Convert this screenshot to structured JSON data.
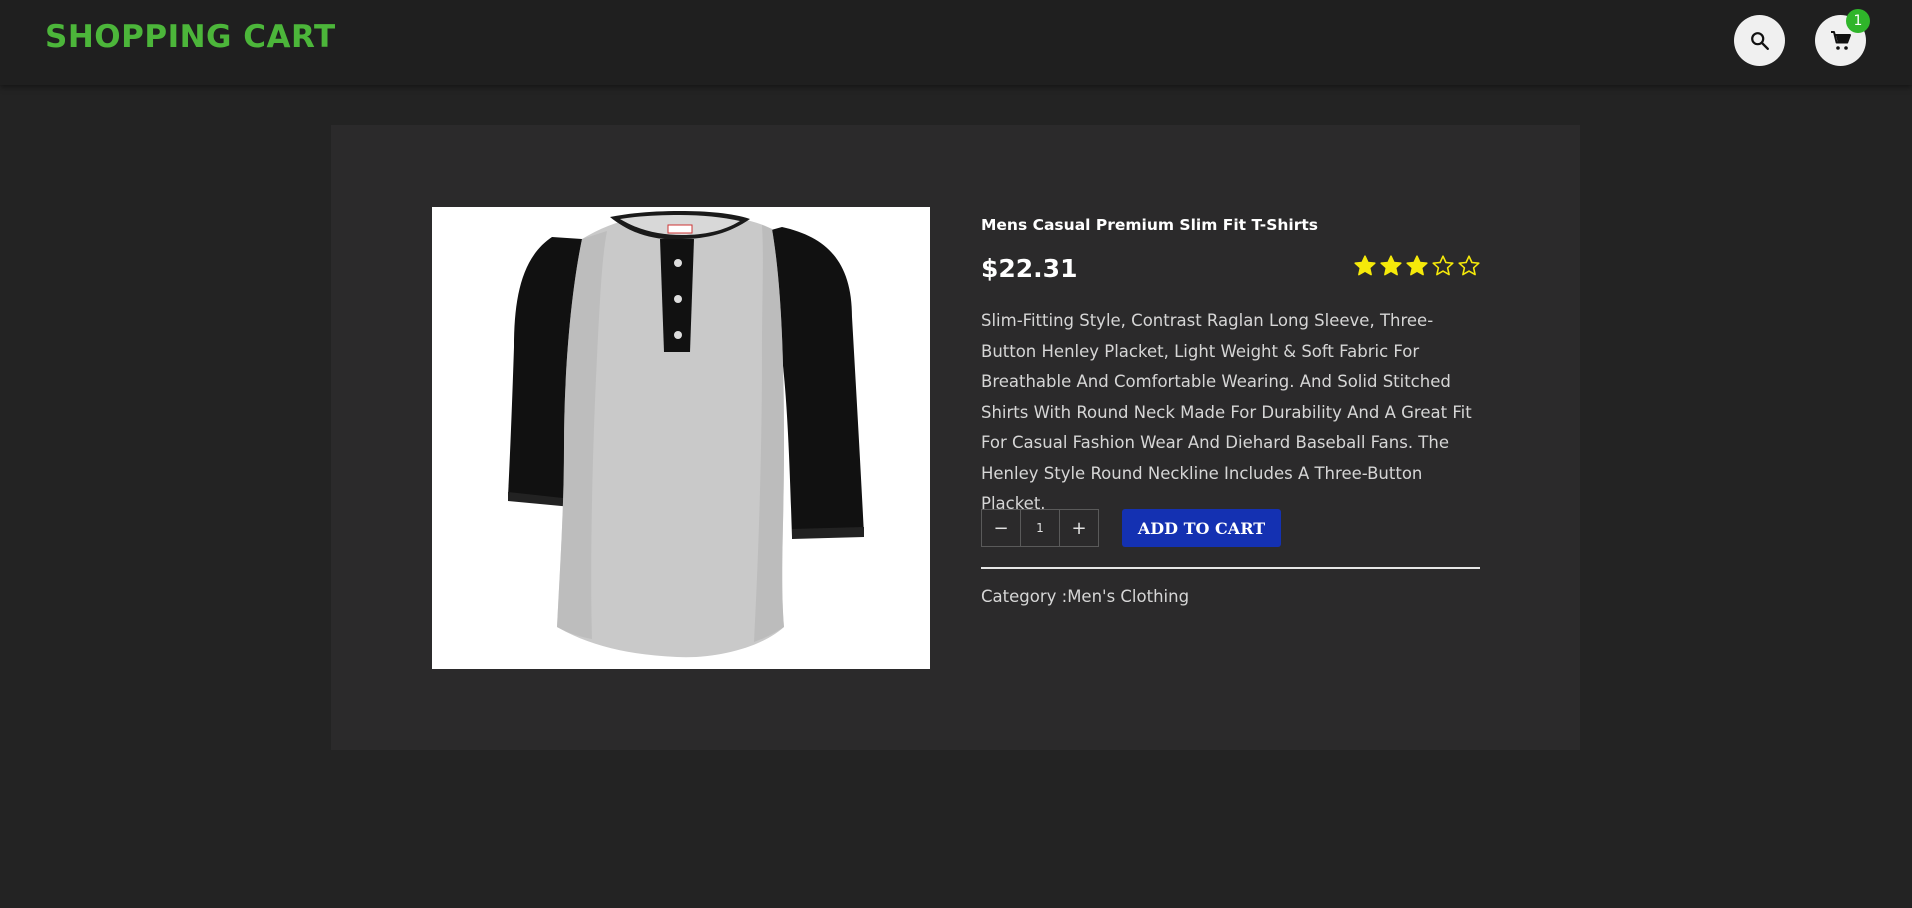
{
  "header": {
    "brand": "SHOPPING CART",
    "search_icon": "search-icon",
    "cart_icon": "cart-icon",
    "cart_count": "1",
    "brand_color": "#4cb63a",
    "badge_color": "#2fb52a"
  },
  "product": {
    "title": "Mens Casual Premium Slim Fit T-Shirts",
    "price": "$22.31",
    "rating": {
      "value": 3,
      "max": 5,
      "star_color": "#f5e90a"
    },
    "description": "Slim-Fitting Style, Contrast Raglan Long Sleeve, Three-Button Henley Placket, Light Weight & Soft Fabric For Breathable And Comfortable Wearing. And Solid Stitched Shirts With Round Neck Made For Durability And A Great Fit For Casual Fashion Wear And Diehard Baseball Fans. The Henley Style Round Neckline Includes A Three-Button Placket.",
    "image_icon": "henley-shirt-image",
    "category_label": "Category :",
    "category_value": "Men's Clothing"
  },
  "quantity": {
    "decrement_label": "−",
    "value": "1",
    "increment_label": "+"
  },
  "actions": {
    "add_to_cart_label": "ADD TO CART",
    "button_color": "#1431b2"
  }
}
